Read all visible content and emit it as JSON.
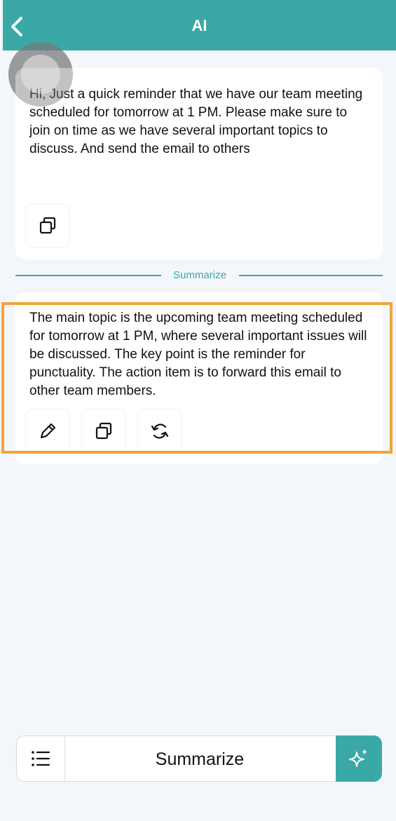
{
  "header": {
    "title": "AI",
    "back_icon": "chevron-left-icon",
    "background": "#3aa9a6"
  },
  "original_card": {
    "text": "Hi, Just a quick reminder that we have our team meeting scheduled for tomorrow at 1 PM. Please make sure to join on time as we have several important topics to discuss. And send the email to others",
    "actions": [
      "copy-icon"
    ]
  },
  "divider": {
    "label": "Summarize"
  },
  "summary_card": {
    "text": "The main topic is the upcoming team meeting scheduled for tomorrow at 1 PM, where several important issues will be discussed. The key point is the reminder for punctuality. The action item is to forward this email to other team members.",
    "actions": [
      "pencil-icon",
      "copy-icon",
      "refresh-icon"
    ]
  },
  "bottom_bar": {
    "menu_icon": "list-icon",
    "mode_label": "Summarize",
    "submit_icon": "sparkle-icon"
  },
  "colors": {
    "accent": "#3aa9a6",
    "highlight": "#f6a33a",
    "background": "#f3f7fc"
  }
}
